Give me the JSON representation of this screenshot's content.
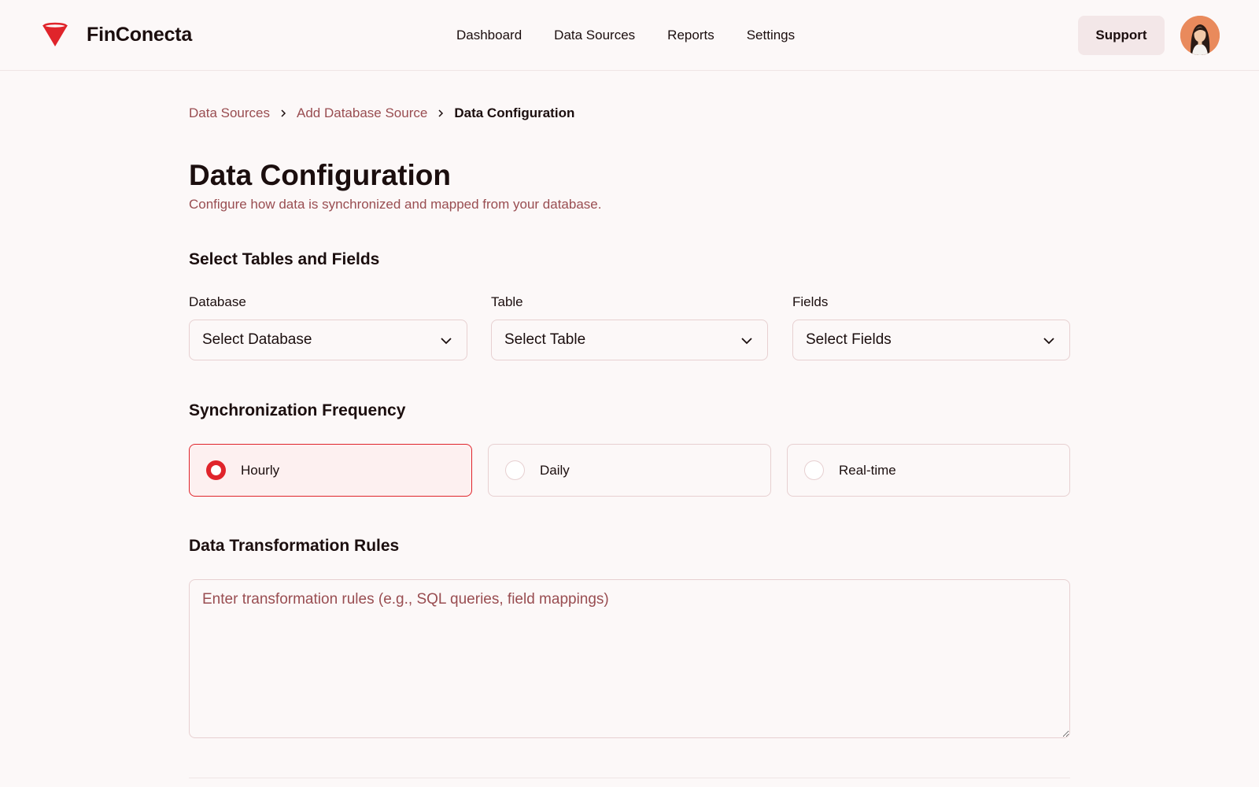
{
  "brand": {
    "name": "FinConecta",
    "accent_color": "#e0242b",
    "logo_icon": "funnel-logo-icon"
  },
  "nav": {
    "items": [
      "Dashboard",
      "Data Sources",
      "Reports",
      "Settings"
    ]
  },
  "header": {
    "support_label": "Support",
    "avatar_icon": "user-avatar"
  },
  "breadcrumb": {
    "items": [
      "Data Sources",
      "Add Database Source"
    ],
    "current": "Data Configuration",
    "separator_icon": "chevron-right-icon"
  },
  "page": {
    "title": "Data Configuration",
    "subtitle": "Configure how data is synchronized and mapped from your database."
  },
  "tables_section": {
    "title": "Select Tables and Fields",
    "fields": [
      {
        "label": "Database",
        "value": "Select Database"
      },
      {
        "label": "Table",
        "value": "Select Table"
      },
      {
        "label": "Fields",
        "value": "Select Fields"
      }
    ]
  },
  "sync_section": {
    "title": "Synchronization Frequency",
    "options": [
      {
        "label": "Hourly",
        "selected": true
      },
      {
        "label": "Daily",
        "selected": false
      },
      {
        "label": "Real-time",
        "selected": false
      }
    ]
  },
  "rules_section": {
    "title": "Data Transformation Rules",
    "placeholder": "Enter transformation rules (e.g., SQL queries, field mappings)",
    "value": ""
  },
  "colors": {
    "accent": "#e0242b",
    "muted_text": "#994d51",
    "border": "#e7d0d1",
    "background": "#fcf8f8",
    "support_button_bg": "#f3e7e8"
  }
}
